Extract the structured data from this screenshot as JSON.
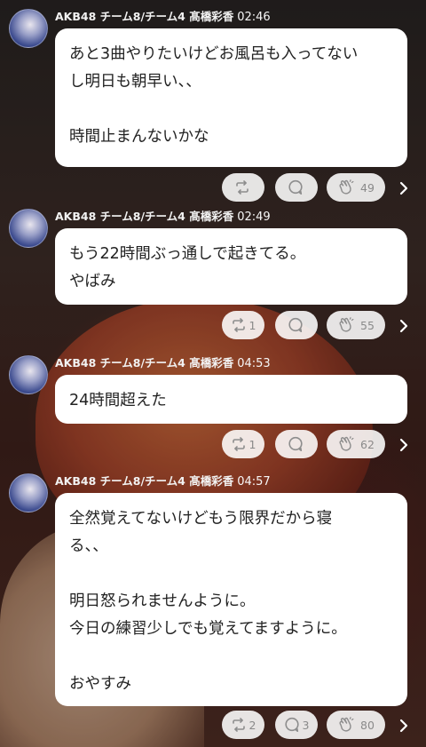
{
  "posts": [
    {
      "author": "AKB48 チーム8/チーム4 髙橋彩香",
      "time": "02:46",
      "text": "あと3曲やりたいけどお風呂も入ってない\nし明日も朝早い、、\n\n時間止まんないかな",
      "repost_count": "",
      "comment_count": "",
      "like_count": "49"
    },
    {
      "author": "AKB48 チーム8/チーム4 髙橋彩香",
      "time": "02:49",
      "text": "もう22時間ぶっ通しで起きてる。\nやばみ",
      "repost_count": "1",
      "comment_count": "",
      "like_count": "55"
    },
    {
      "author": "AKB48 チーム8/チーム4 髙橋彩香",
      "time": "04:53",
      "text": "24時間超えた",
      "repost_count": "1",
      "comment_count": "",
      "like_count": "62"
    },
    {
      "author": "AKB48 チーム8/チーム4 髙橋彩香",
      "time": "04:57",
      "text": "全然覚えてないけどもう限界だから寝\nる、、\n\n明日怒られませんように。\n今日の練習少しでも覚えてますように。\n\nおやすみ",
      "repost_count": "2",
      "comment_count": "3",
      "like_count": "80"
    }
  ],
  "icons": {
    "repost": "repost-icon",
    "comment": "comment-icon",
    "like": "clap-icon",
    "more": "chevron-right-icon"
  }
}
